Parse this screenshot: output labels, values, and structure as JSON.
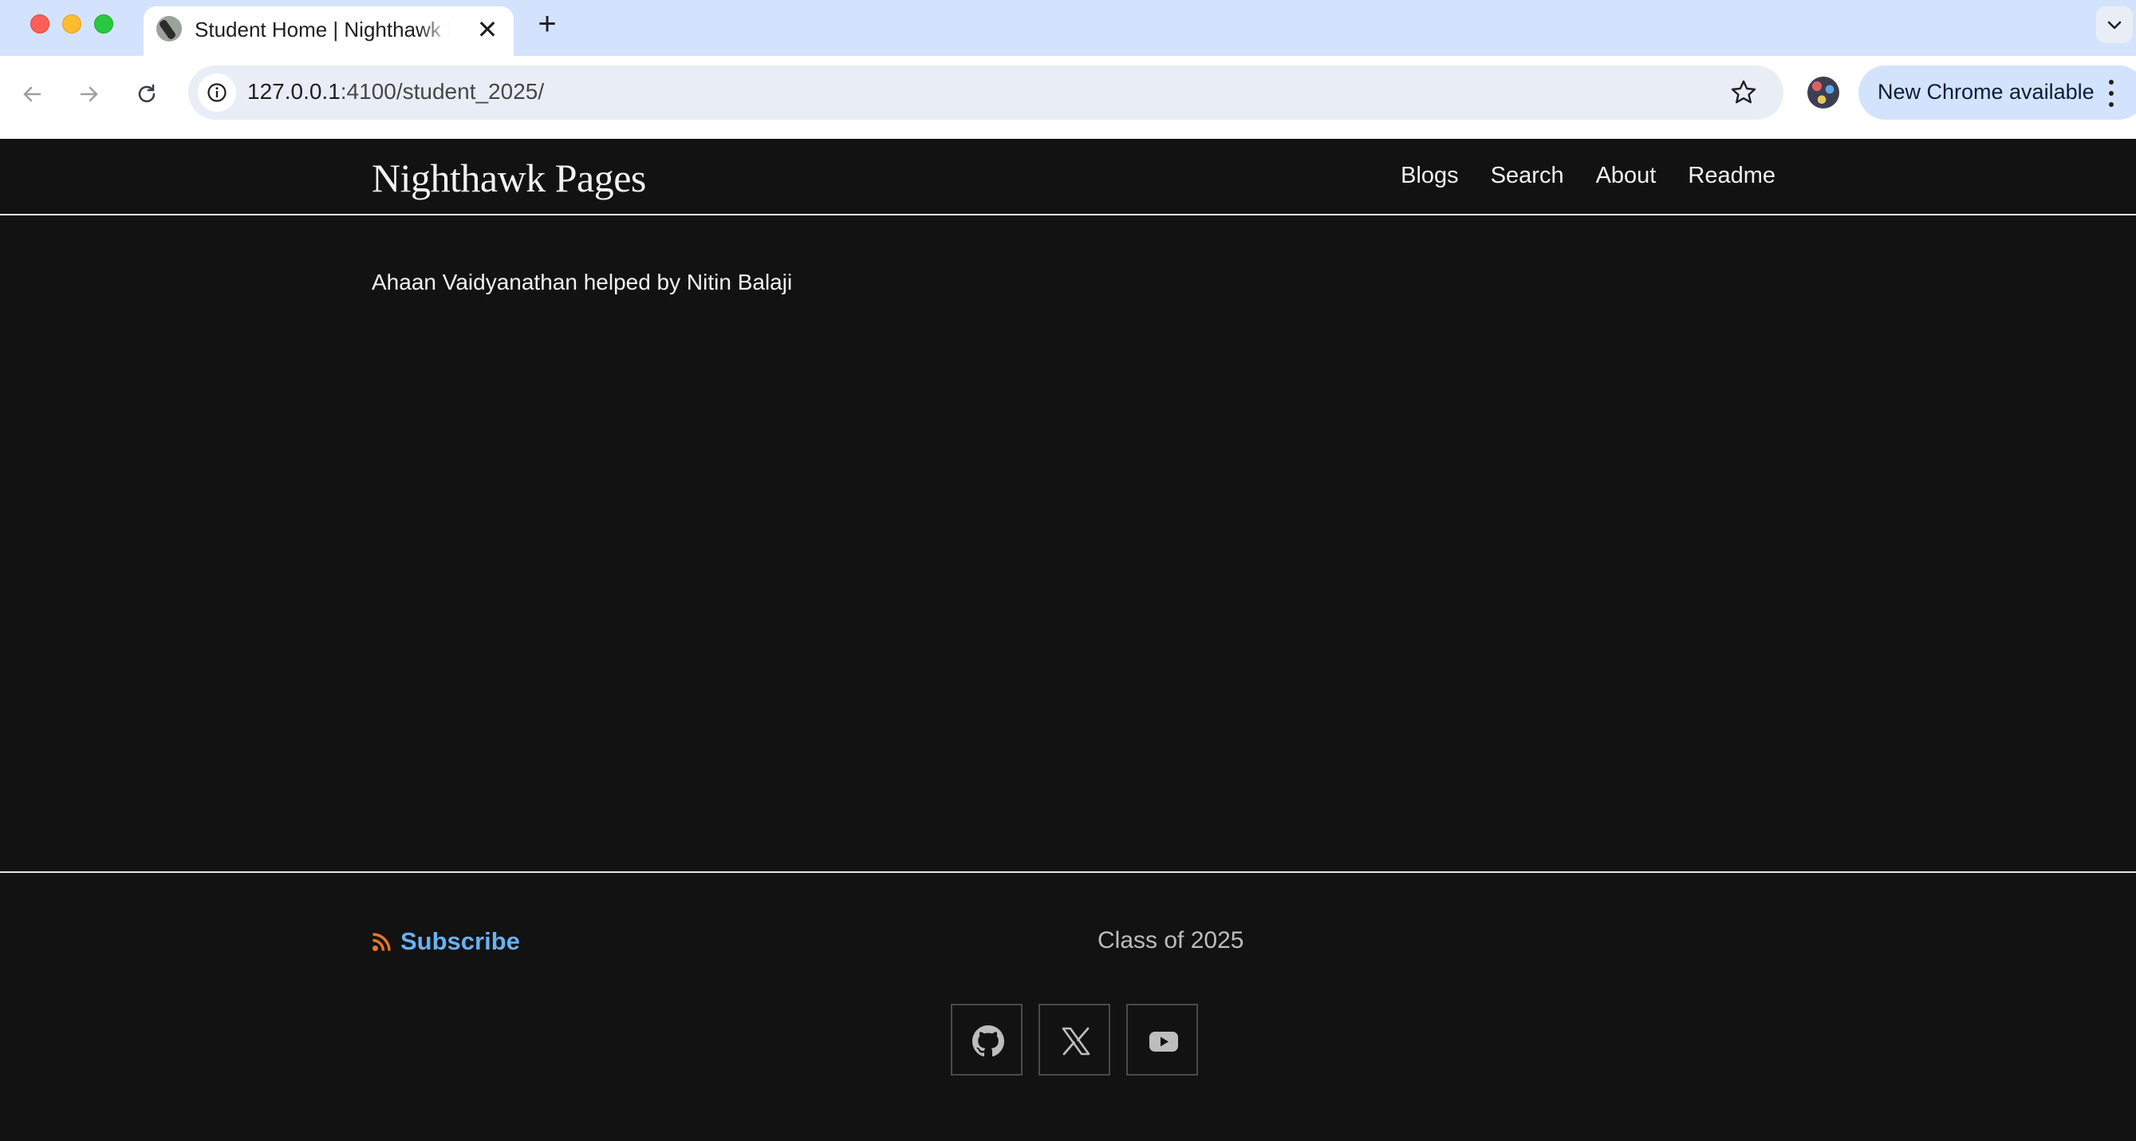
{
  "browser": {
    "tab": {
      "title": "Student Home | Nighthawk Pages",
      "close_glyph": "✕"
    },
    "new_tab_glyph": "+",
    "address": {
      "host": "127.0.0.1",
      "path": ":4100/student_2025/"
    },
    "update_button": "New Chrome available",
    "icons": [
      "back-arrow-icon",
      "forward-arrow-icon",
      "reload-icon",
      "site-info-icon",
      "bookmark-star-icon",
      "tab-search-icon",
      "kebab-menu-icon"
    ]
  },
  "site": {
    "title": "Nighthawk Pages",
    "nav": [
      {
        "label": "Blogs"
      },
      {
        "label": "Search"
      },
      {
        "label": "About"
      },
      {
        "label": "Readme"
      }
    ]
  },
  "main": {
    "byline": "Ahaan Vaidyanathan helped by Nitin Balaji"
  },
  "footer": {
    "subscribe_label": "Subscribe",
    "class_label": "Class of 2025",
    "social": [
      "github-icon",
      "x-twitter-icon",
      "youtube-icon"
    ]
  },
  "colors": {
    "page_bg": "#121212",
    "text": "#f2f2f2",
    "link_blue": "#6ab0f3",
    "rss_orange": "#e8762b",
    "tabbar_bg": "#d3e3fd"
  }
}
